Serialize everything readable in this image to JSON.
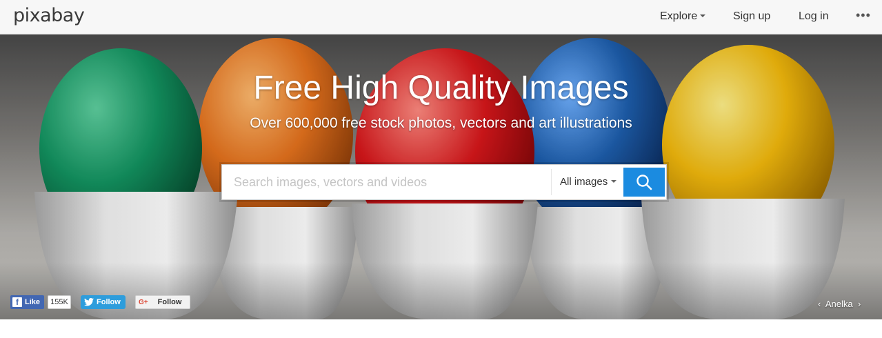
{
  "header": {
    "logo": "pixabay",
    "nav": {
      "explore": "Explore",
      "signup": "Sign up",
      "login": "Log in",
      "more": "•••"
    }
  },
  "hero": {
    "title": "Free High Quality Images",
    "subtitle": "Over 600,000 free stock photos, vectors and art illustrations",
    "search": {
      "placeholder": "Search images, vectors and videos",
      "value": "",
      "type_selected": "All images"
    },
    "photo_credit": "Anelka",
    "colors": {
      "accent": "#1b8be0",
      "egg_green": "#139461",
      "egg_orange": "#e6731e",
      "egg_red": "#d8171b",
      "egg_blue": "#1e5fae",
      "egg_yellow": "#f2b90c"
    }
  },
  "social": {
    "facebook_label": "Like",
    "facebook_count": "155K",
    "twitter_label": "Follow",
    "gplus_mark": "G+",
    "gplus_label": "Follow"
  },
  "icons": [
    "search-icon",
    "chevron-down-icon",
    "more-icon",
    "facebook-icon",
    "twitter-icon",
    "google-plus-icon",
    "chevron-left-icon",
    "chevron-right-icon"
  ]
}
